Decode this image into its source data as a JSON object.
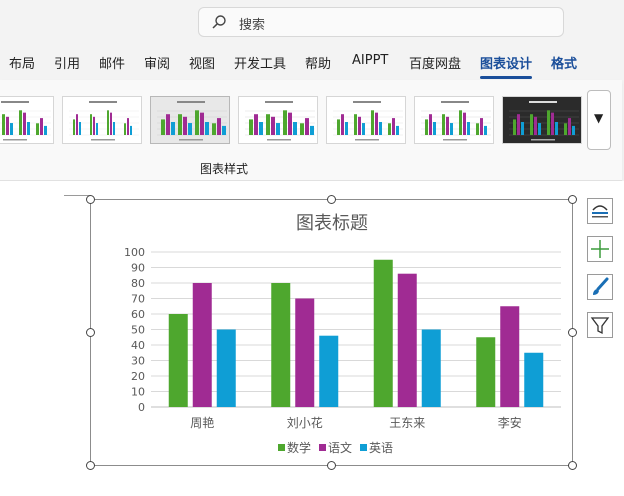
{
  "search": {
    "placeholder": "搜索"
  },
  "tabs": [
    {
      "label": "布局"
    },
    {
      "label": "引用"
    },
    {
      "label": "邮件"
    },
    {
      "label": "审阅"
    },
    {
      "label": "视图"
    },
    {
      "label": "开发工具"
    },
    {
      "label": "帮助"
    },
    {
      "label": "AIPPT"
    },
    {
      "label": "百度网盘"
    },
    {
      "label": "图表设计",
      "active": true
    },
    {
      "label": "格式"
    }
  ],
  "ribbon": {
    "group_label": "图表样式"
  },
  "chart_data": {
    "type": "bar",
    "title": "图表标题",
    "categories": [
      "周艳",
      "刘小花",
      "王东来",
      "李安"
    ],
    "series": [
      {
        "name": "数学",
        "values": [
          60,
          80,
          95,
          45
        ],
        "color": "#4ea72e"
      },
      {
        "name": "语文",
        "values": [
          80,
          70,
          86,
          65
        ],
        "color": "#a02b93"
      },
      {
        "name": "英语",
        "values": [
          50,
          46,
          50,
          35
        ],
        "color": "#0f9ed5"
      }
    ],
    "ylim": [
      0,
      100
    ],
    "yticks": [
      "0",
      "10",
      "20",
      "30",
      "40",
      "50",
      "60",
      "70",
      "80",
      "90",
      "100"
    ],
    "grid": true,
    "legend": "bottom"
  },
  "side_buttons": [
    "chart-elements-icon",
    "add-element-icon",
    "chart-styles-brush-icon",
    "chart-filter-icon"
  ]
}
